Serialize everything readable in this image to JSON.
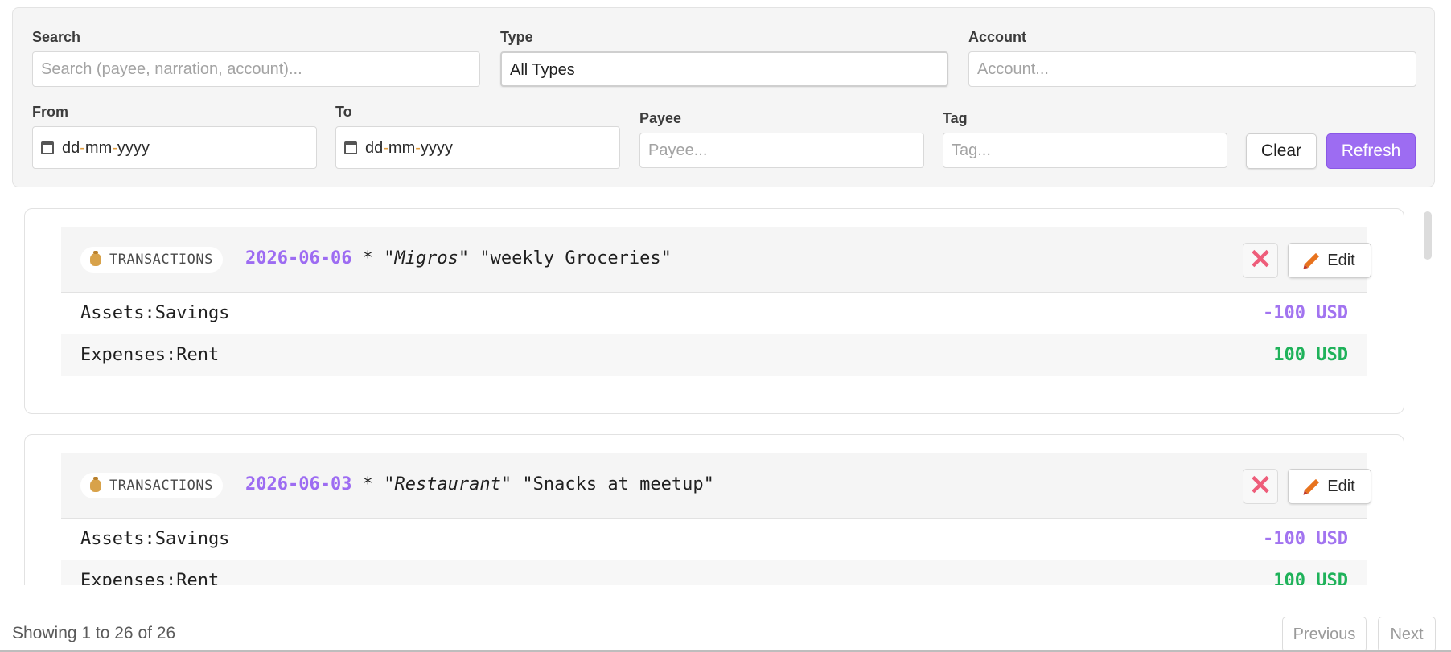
{
  "filters": {
    "search": {
      "label": "Search",
      "placeholder": "Search (payee, narration, account)..."
    },
    "type": {
      "label": "Type",
      "value": "All Types"
    },
    "account": {
      "label": "Account",
      "placeholder": "Account..."
    },
    "from": {
      "label": "From",
      "value_d": "dd",
      "value_m": "mm",
      "value_y": "yyyy"
    },
    "to": {
      "label": "To",
      "value_d": "dd",
      "value_m": "mm",
      "value_y": "yyyy"
    },
    "payee": {
      "label": "Payee",
      "placeholder": "Payee..."
    },
    "tag": {
      "label": "Tag",
      "placeholder": "Tag..."
    },
    "clear_label": "Clear",
    "refresh_label": "Refresh"
  },
  "transactions": [
    {
      "badge": "TRANSACTIONS",
      "date": "2026-06-06",
      "flag": "*",
      "payee": "\"Migros\"",
      "narration": "\"weekly Groceries\"",
      "edit_label": "Edit",
      "delete_glyph": "✕",
      "postings": [
        {
          "account": "Assets:Savings",
          "amount": "-100 USD"
        },
        {
          "account": "Expenses:Rent",
          "amount": "100 USD"
        }
      ]
    },
    {
      "badge": "TRANSACTIONS",
      "date": "2026-06-03",
      "flag": "*",
      "payee": "\"Restaurant\"",
      "narration": "\"Snacks at meetup\"",
      "edit_label": "Edit",
      "delete_glyph": "✕",
      "postings": [
        {
          "account": "Assets:Savings",
          "amount": "-100 USD"
        },
        {
          "account": "Expenses:Rent",
          "amount": "100 USD"
        }
      ]
    }
  ],
  "pagination": {
    "summary": "Showing 1 to 26 of 26",
    "previous_label": "Previous",
    "next_label": "Next"
  },
  "colors": {
    "accent": "#9d6cf2",
    "negative": "#a274f0",
    "positive": "#1fb25a",
    "delete": "#ee5d7a"
  }
}
